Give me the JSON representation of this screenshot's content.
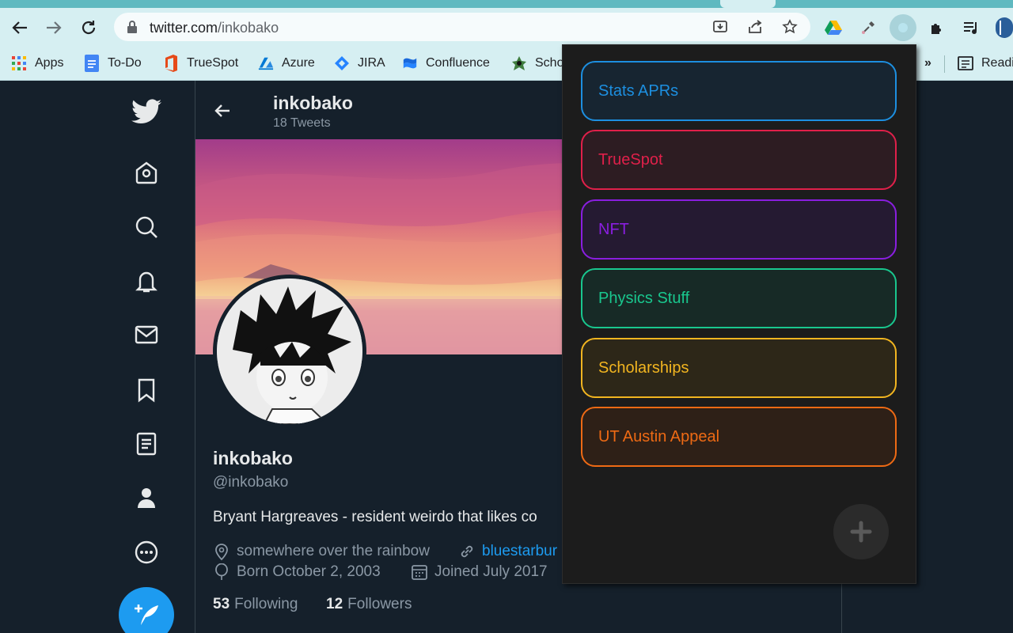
{
  "browser": {
    "url_host": "twitter.com",
    "url_path": "/inkobako",
    "bookmarks": [
      {
        "label": "Apps",
        "icon": "apps-grid-icon"
      },
      {
        "label": "To-Do",
        "icon": "docs-icon"
      },
      {
        "label": "TrueSpot",
        "icon": "office-icon"
      },
      {
        "label": "Azure",
        "icon": "azure-icon"
      },
      {
        "label": "JIRA",
        "icon": "jira-icon"
      },
      {
        "label": "Confluence",
        "icon": "confluence-icon"
      },
      {
        "label": "Scho",
        "icon": "scholar-icon"
      }
    ],
    "overflow_label": "»",
    "reading_list_label": "Readi"
  },
  "twitter": {
    "header_name": "inkobako",
    "header_count": "18 Tweets",
    "profile": {
      "name": "inkobako",
      "handle": "@inkobako",
      "bio": "Bryant Hargreaves - resident weirdo that likes co",
      "location": "somewhere over the rainbow",
      "website": "bluestarbur",
      "birthday": "Born October 2, 2003",
      "joined": "Joined July 2017",
      "following_count": "53",
      "following_label": "Following",
      "followers_count": "12",
      "followers_label": "Followers"
    }
  },
  "popup": {
    "folders": [
      {
        "label": "Stats APRs",
        "color": "#1d8fe0",
        "bg": "#172531"
      },
      {
        "label": "TrueSpot",
        "color": "#e0204a",
        "bg": "#2d1c22"
      },
      {
        "label": "NFT",
        "color": "#8a1ee0",
        "bg": "#251a32"
      },
      {
        "label": "Physics Stuff",
        "color": "#19c78e",
        "bg": "#172a26"
      },
      {
        "label": "Scholarships",
        "color": "#f2b520",
        "bg": "#2d2718"
      },
      {
        "label": "UT Austin Appeal",
        "color": "#ee6a14",
        "bg": "#2e2017"
      }
    ],
    "add_label": "+"
  }
}
